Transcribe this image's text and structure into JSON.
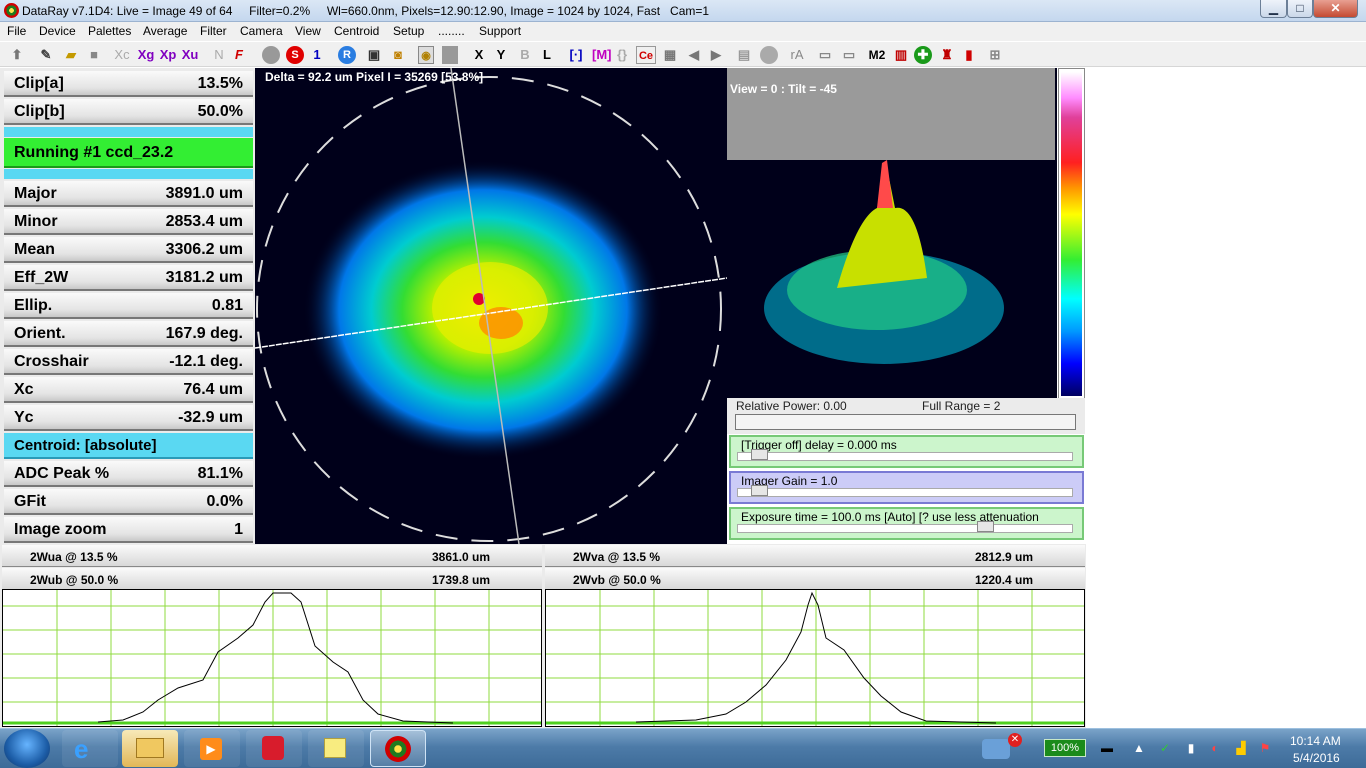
{
  "window": {
    "title": "DataRay v7.1D4: Live = Image 49 of 64     Filter=0.2%     Wl=660.0nm, Pixels=12.90:12.90, Image = 1024 by 1024, Fast   Cam=1",
    "min_label": "▁",
    "max_label": "□",
    "close_label": "✕"
  },
  "menu": [
    "File",
    "Device",
    "Palettes",
    "Average",
    "Filter",
    "Camera",
    "View",
    "Centroid",
    "Setup",
    "........",
    "Support"
  ],
  "toolbar": {
    "xc": "Xc",
    "xg": "Xg",
    "xp": "Xp",
    "xu": "Xu",
    "n": "N",
    "f": "F",
    "s": "S",
    "one": "1",
    "r": "R",
    "x": "X",
    "y": "Y",
    "b": "B",
    "l": "L",
    "m2": "M2",
    "ra": "rA",
    "ce": "Ce"
  },
  "results": [
    {
      "label": "Clip[a]",
      "value": "13.5%"
    },
    {
      "label": "Clip[b]",
      "value": "50.0%"
    }
  ],
  "status": {
    "running": "Running #1 ccd_23.2"
  },
  "measurements": [
    {
      "label": "Major",
      "value": "3891.0 um"
    },
    {
      "label": "Minor",
      "value": "2853.4 um"
    },
    {
      "label": "Mean",
      "value": "3306.2 um"
    },
    {
      "label": "Eff_2W",
      "value": "3181.2 um"
    },
    {
      "label": "Ellip.",
      "value": "0.81"
    },
    {
      "label": "Orient.",
      "value": "167.9 deg."
    },
    {
      "label": "Crosshair",
      "value": "-12.1 deg."
    },
    {
      "label": "Xc",
      "value": "76.4 um"
    },
    {
      "label": "Yc",
      "value": "-32.9 um"
    }
  ],
  "centroid": {
    "label": "Centroid: [absolute]"
  },
  "extra": [
    {
      "label": "ADC Peak %",
      "value": "81.1%"
    },
    {
      "label": "GFit",
      "value": "0.0%"
    },
    {
      "label": "Image zoom",
      "value": "1"
    }
  ],
  "beam": {
    "delta_text": "Delta = 92.2 um Pixel I = 35269 [53.8%]"
  },
  "view3d": {
    "text": "View = 0 : Tilt = -45"
  },
  "power": {
    "relative": "Relative Power: 0.00",
    "full_range": "Full Range = 2"
  },
  "controls": {
    "trigger": "[Trigger off] delay = 0.000 ms",
    "gain": "Imager Gain = 1.0",
    "exposure": "Exposure time = 100.0 ms [Auto]   [?  use less attenuation"
  },
  "profiles": {
    "wua": {
      "label": "2Wua @ 13.5 %",
      "value": "3861.0 um"
    },
    "wub": {
      "label": "2Wub @ 50.0 %",
      "value": "1739.8 um"
    },
    "wva": {
      "label": "2Wva @ 13.5 %",
      "value": "2812.9 um"
    },
    "wvb": {
      "label": "2Wvb @ 50.0 %",
      "value": "1220.4 um"
    }
  },
  "taskbar": {
    "battery": "100%",
    "time": "10:14 AM",
    "date": "5/4/2016"
  },
  "colors": {
    "accent_cyan": "#5ad8f2",
    "running_green": "#33ee33",
    "profile_grid": "#8fdb3f"
  }
}
